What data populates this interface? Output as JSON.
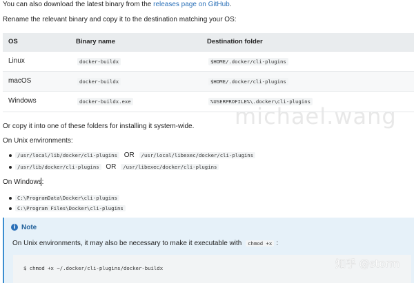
{
  "intro": {
    "prefix": "You can also download the latest binary from the ",
    "link": "releases page on GitHub",
    "suffix": ".",
    "line2": "Rename the relevant binary and copy it to the destination matching your OS:"
  },
  "table": {
    "headers": [
      "OS",
      "Binary name",
      "Destination folder"
    ],
    "rows": [
      {
        "os": "Linux",
        "binary": "docker-buildx",
        "dest": "$HOME/.docker/cli-plugins"
      },
      {
        "os": "macOS",
        "binary": "docker-buildx",
        "dest": "$HOME/.docker/cli-plugins"
      },
      {
        "os": "Windows",
        "binary": "docker-buildx.exe",
        "dest": "%USERPROFILE%\\.docker\\cli-plugins"
      }
    ]
  },
  "system_wide": "Or copy it into one of these folders for installing it system-wide.",
  "unix": {
    "heading": "On Unix environments:",
    "items": [
      {
        "a": "/usr/local/lib/docker/cli-plugins",
        "or": "OR",
        "b": "/usr/local/libexec/docker/cli-plugins"
      },
      {
        "a": "/usr/lib/docker/cli-plugins",
        "or": "OR",
        "b": "/usr/libexec/docker/cli-plugins"
      }
    ]
  },
  "windows": {
    "heading": "On Windows:",
    "items": [
      "C:\\ProgramData\\Docker\\cli-plugins",
      "C:\\Program Files\\Docker\\cli-plugins"
    ]
  },
  "note": {
    "icon": "info-icon",
    "title": "Note",
    "text_prefix": "On Unix environments, it may also be necessary to make it executable with",
    "code": "chmod +x",
    "text_suffix": ":",
    "command": "$ chmod +x ~/.docker/cli-plugins/docker-buildx"
  },
  "watermarks": {
    "author": "michael.wang",
    "zhihu": "知乎 @storm"
  },
  "colors": {
    "link": "#2a70b8",
    "note_bg": "#e6f1f9",
    "note_border": "#3a8dd0",
    "table_header_bg": "#e9ecee"
  }
}
